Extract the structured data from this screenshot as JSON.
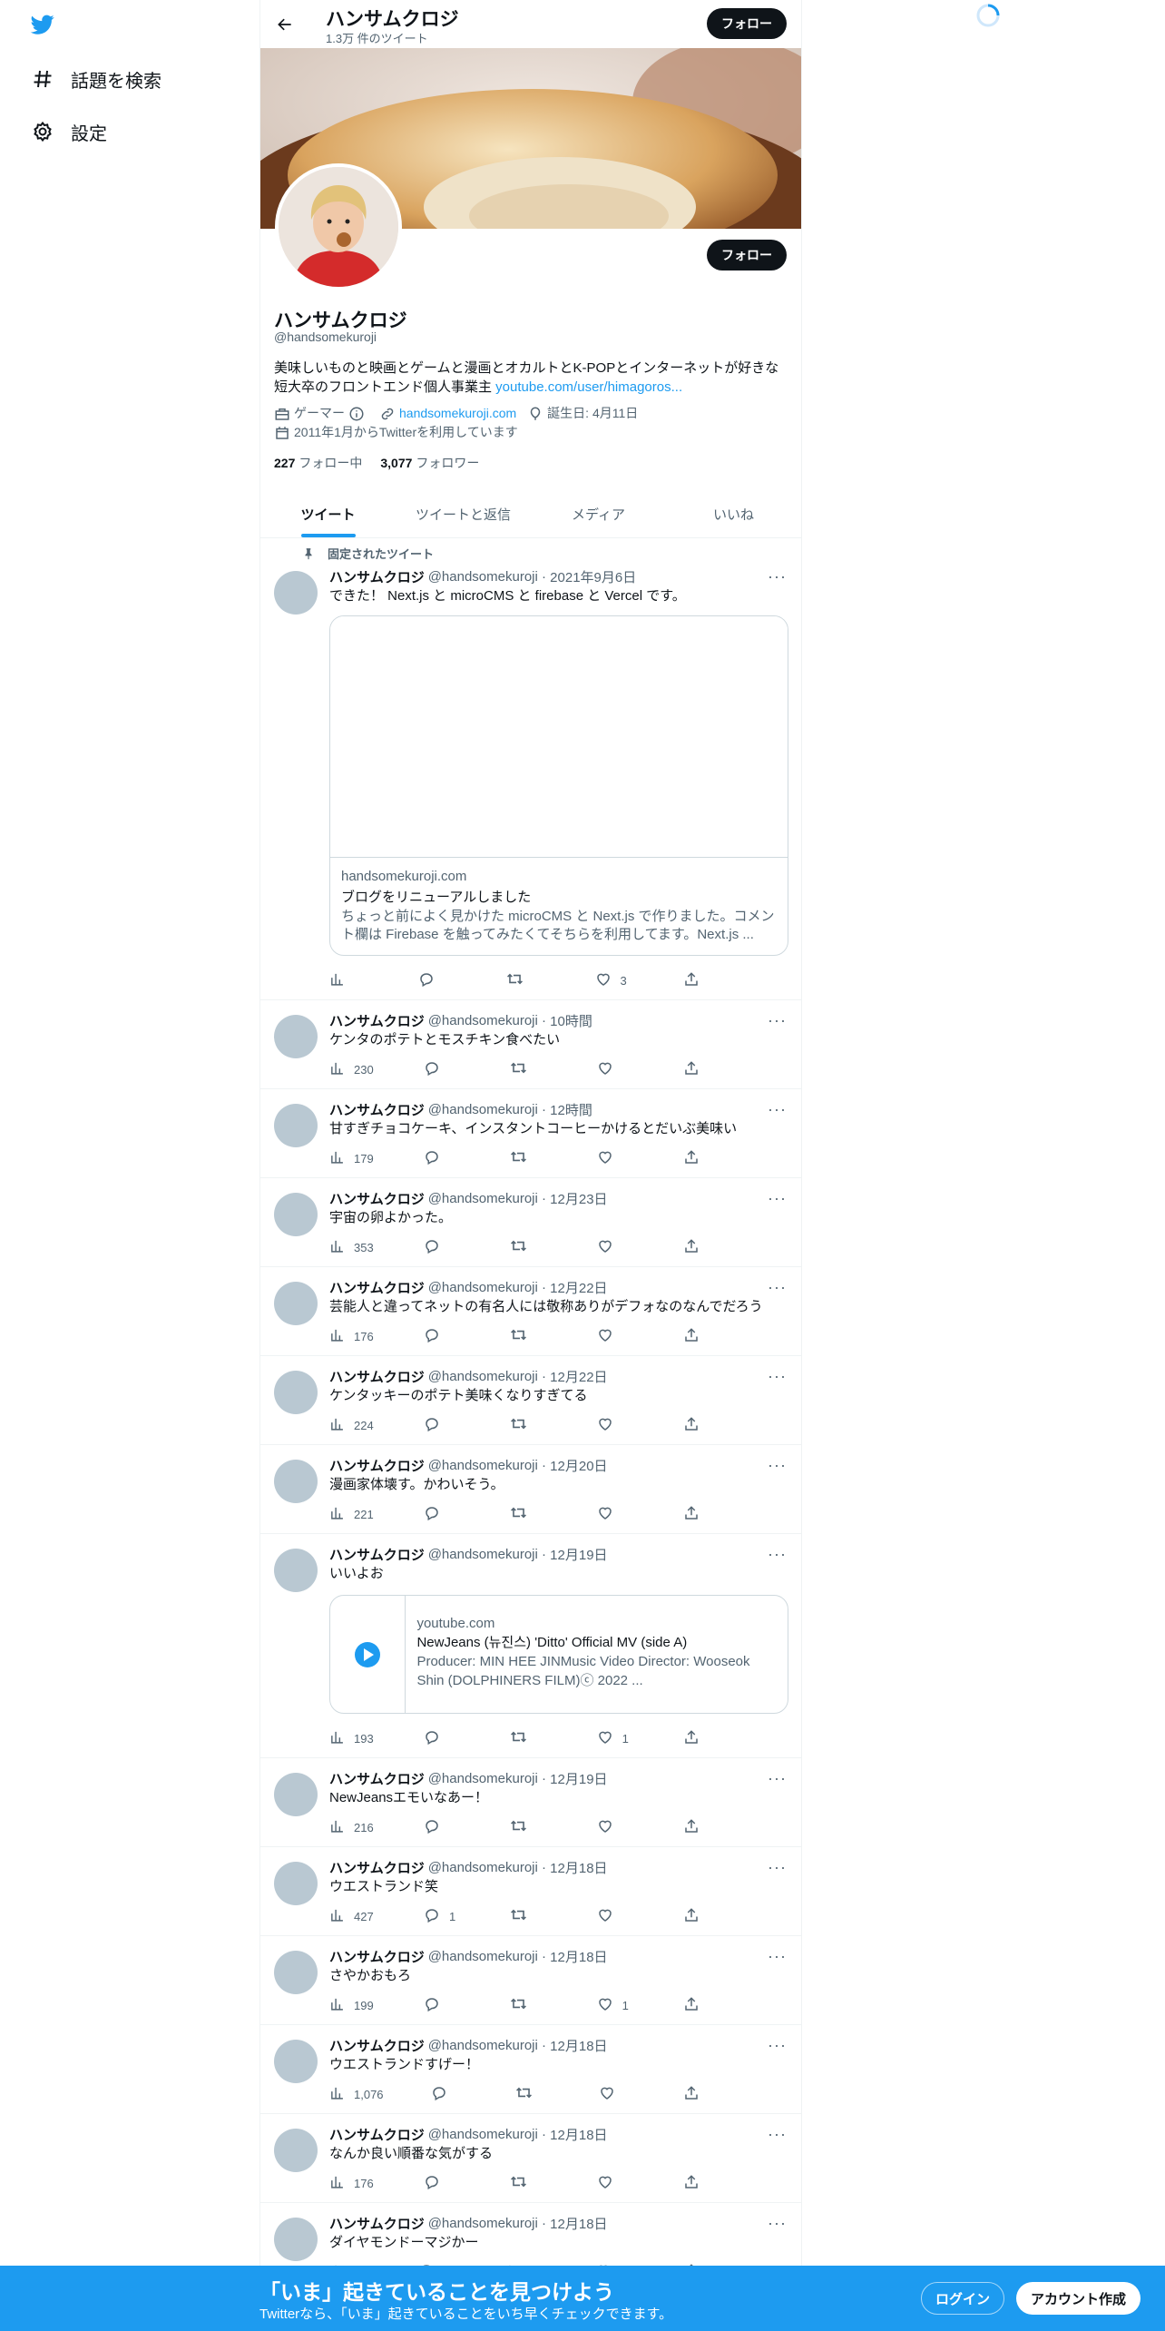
{
  "nav": {
    "explore_label": "話題を検索",
    "settings_label": "設定"
  },
  "header": {
    "title": "ハンサムクロジ",
    "tweet_count": "1.3万 件のツイート",
    "follow_label": "フォロー"
  },
  "profile": {
    "name": "ハンサムクロジ",
    "handle": "@handsomekuroji",
    "follow_label": "フォロー",
    "bio_text": "美味しいものと映画とゲームと漫画とオカルトとK-POPとインターネットが好きな短大卒のフロントエンド個人事業主 ",
    "bio_link": "youtube.com/user/himagoros...",
    "category": "ゲーマー",
    "website": "handsomekuroji.com",
    "birthday": "誕生日: 4月11日",
    "joined": "2011年1月からTwitterを利用しています",
    "following_count": "227",
    "following_label": "フォロー中",
    "followers_count": "3,077",
    "followers_label": "フォロワー"
  },
  "tabs": [
    "ツイート",
    "ツイートと返信",
    "メディア",
    "いいね"
  ],
  "pinned_label": "固定されたツイート",
  "tweets": [
    {
      "name": "ハンサムクロジ",
      "handle": "@handsomekuroji",
      "time": "2021年9月6日",
      "text": "できた！ Next.js と microCMS と firebase と Vercel です。",
      "views": "",
      "replies": "",
      "retweets": "",
      "likes": "3",
      "card": {
        "domain": "handsomekuroji.com",
        "title": "ブログをリニューアルしました",
        "desc": "ちょっと前によく見かけた microCMS と Next.js で作りました。コメント欄は Firebase を触ってみたくてそちらを利用してます。Next.js ..."
      }
    },
    {
      "name": "ハンサムクロジ",
      "handle": "@handsomekuroji",
      "time": "10時間",
      "text": "ケンタのポテトとモスチキン食べたい",
      "views": "230",
      "replies": "",
      "retweets": "",
      "likes": ""
    },
    {
      "name": "ハンサムクロジ",
      "handle": "@handsomekuroji",
      "time": "12時間",
      "text": "甘すぎチョコケーキ、インスタントコーヒーかけるとだいぶ美味い",
      "views": "179",
      "replies": "",
      "retweets": "",
      "likes": ""
    },
    {
      "name": "ハンサムクロジ",
      "handle": "@handsomekuroji",
      "time": "12月23日",
      "text": "宇宙の卵よかった。",
      "views": "353",
      "replies": "",
      "retweets": "",
      "likes": ""
    },
    {
      "name": "ハンサムクロジ",
      "handle": "@handsomekuroji",
      "time": "12月22日",
      "text": "芸能人と違ってネットの有名人には敬称ありがデフォなのなんでだろう",
      "views": "176",
      "replies": "",
      "retweets": "",
      "likes": ""
    },
    {
      "name": "ハンサムクロジ",
      "handle": "@handsomekuroji",
      "time": "12月22日",
      "text": "ケンタッキーのポテト美味くなりすぎてる",
      "views": "224",
      "replies": "",
      "retweets": "",
      "likes": ""
    },
    {
      "name": "ハンサムクロジ",
      "handle": "@handsomekuroji",
      "time": "12月20日",
      "text": "漫画家体壊す。かわいそう。",
      "views": "221",
      "replies": "",
      "retweets": "",
      "likes": ""
    },
    {
      "name": "ハンサムクロジ",
      "handle": "@handsomekuroji",
      "time": "12月19日",
      "text": "いいよお",
      "views": "193",
      "replies": "",
      "retweets": "",
      "likes": "1",
      "card2": {
        "domain": "youtube.com",
        "title": "NewJeans (뉴진스) 'Ditto' Official MV (side A)",
        "desc": "Producer: MIN HEE JINMusic Video Director: Wooseok Shin (DOLPHINERS FILM)ⓒ 2022 ..."
      }
    },
    {
      "name": "ハンサムクロジ",
      "handle": "@handsomekuroji",
      "time": "12月19日",
      "text": "NewJeansエモいなあー！",
      "views": "216",
      "replies": "",
      "retweets": "",
      "likes": ""
    },
    {
      "name": "ハンサムクロジ",
      "handle": "@handsomekuroji",
      "time": "12月18日",
      "text": "ウエストランド笑",
      "views": "427",
      "replies": "1",
      "retweets": "",
      "likes": ""
    },
    {
      "name": "ハンサムクロジ",
      "handle": "@handsomekuroji",
      "time": "12月18日",
      "text": "さやかおもろ",
      "views": "199",
      "replies": "",
      "retweets": "",
      "likes": "1"
    },
    {
      "name": "ハンサムクロジ",
      "handle": "@handsomekuroji",
      "time": "12月18日",
      "text": "ウエストランドすげー！",
      "views": "1,076",
      "replies": "",
      "retweets": "",
      "likes": ""
    },
    {
      "name": "ハンサムクロジ",
      "handle": "@handsomekuroji",
      "time": "12月18日",
      "text": "なんか良い順番な気がする",
      "views": "176",
      "replies": "",
      "retweets": "",
      "likes": ""
    },
    {
      "name": "ハンサムクロジ",
      "handle": "@handsomekuroji",
      "time": "12月18日",
      "text": "ダイヤモンドーマジかー",
      "views": "",
      "replies": "",
      "retweets": "",
      "likes": ""
    }
  ],
  "bottom": {
    "headline": "「いま」起きていることを見つけよう",
    "sub": "Twitterなら、「いま」起きていることをいち早くチェックできます。",
    "login": "ログイン",
    "signup": "アカウント作成"
  },
  "colors": {
    "accent": "#1d9bf0",
    "text": "#0f1419",
    "muted": "#536471"
  }
}
